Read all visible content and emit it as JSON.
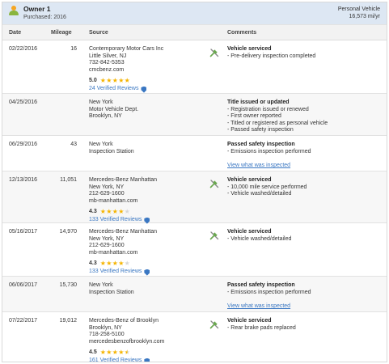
{
  "owner": {
    "title": "Owner 1",
    "purchased": "Purchased: 2016",
    "vehicle_type": "Personal Vehicle",
    "mileage_per_year": "16,573 mi/yr"
  },
  "columns": {
    "date": "Date",
    "mileage": "Mileage",
    "source": "Source",
    "comments": "Comments"
  },
  "rows": [
    {
      "date": "02/22/2016",
      "mileage": "16",
      "source": [
        "Contemporary Motor Cars Inc",
        "Little Silver, NJ",
        "732-842-5353",
        "cmcbenz.com"
      ],
      "rating": "5.0",
      "stars": 5,
      "reviews": "24 Verified Reviews",
      "icon": "wrench-screwdriver-icon",
      "comment_title": "Vehicle serviced",
      "comment_items": [
        "- Pre-delivery inspection completed"
      ],
      "link": ""
    },
    {
      "date": "04/25/2016",
      "mileage": "",
      "source": [
        "New York",
        "Motor Vehicle Dept.",
        "Brooklyn, NY"
      ],
      "rating": "",
      "stars": 0,
      "reviews": "",
      "icon": "",
      "comment_title": "Title issued or updated",
      "comment_items": [
        "- Registration issued or renewed",
        "- First owner reported",
        "- Titled or registered as personal vehicle",
        "- Passed safety inspection"
      ],
      "link": ""
    },
    {
      "date": "06/29/2016",
      "mileage": "43",
      "source": [
        "New York",
        "Inspection Station"
      ],
      "rating": "",
      "stars": 0,
      "reviews": "",
      "icon": "",
      "comment_title": "Passed safety inspection",
      "comment_items": [
        "- Emissions inspection performed"
      ],
      "link": "View what was inspected"
    },
    {
      "date": "12/13/2016",
      "mileage": "11,051",
      "source": [
        "Mercedes-Benz Manhattan",
        "New York, NY",
        "212-629-1600",
        "mb-manhattan.com"
      ],
      "rating": "4.3",
      "stars": 4,
      "reviews": "133 Verified Reviews",
      "icon": "wrench-screwdriver-icon",
      "comment_title": "Vehicle serviced",
      "comment_items": [
        "- 10,000 mile service performed",
        "- Vehicle washed/detailed"
      ],
      "link": ""
    },
    {
      "date": "05/16/2017",
      "mileage": "14,970",
      "source": [
        "Mercedes-Benz Manhattan",
        "New York, NY",
        "212-629-1600",
        "mb-manhattan.com"
      ],
      "rating": "4.3",
      "stars": 4,
      "reviews": "133 Verified Reviews",
      "icon": "wrench-screwdriver-icon",
      "comment_title": "Vehicle serviced",
      "comment_items": [
        "- Vehicle washed/detailed"
      ],
      "link": ""
    },
    {
      "date": "06/06/2017",
      "mileage": "15,730",
      "source": [
        "New York",
        "Inspection Station"
      ],
      "rating": "",
      "stars": 0,
      "reviews": "",
      "icon": "",
      "comment_title": "Passed safety inspection",
      "comment_items": [
        "- Emissions inspection performed"
      ],
      "link": "View what was inspected"
    },
    {
      "date": "07/22/2017",
      "mileage": "19,012",
      "source": [
        "Mercedes-Benz of Brooklyn",
        "Brooklyn, NY",
        "718-258-5100",
        "mercedesbenzofbrooklyn.com"
      ],
      "rating": "4.5",
      "stars": 4.5,
      "reviews": "161 Verified Reviews",
      "icon": "wrench-screwdriver-icon",
      "comment_title": "Vehicle serviced",
      "comment_items": [
        "- Rear brake pads replaced"
      ],
      "link": ""
    }
  ],
  "colors": {
    "owner_bar": "#dde7f3",
    "link": "#3a77c2",
    "star": "#f5b400",
    "tool_icon": "#6aa84f"
  }
}
